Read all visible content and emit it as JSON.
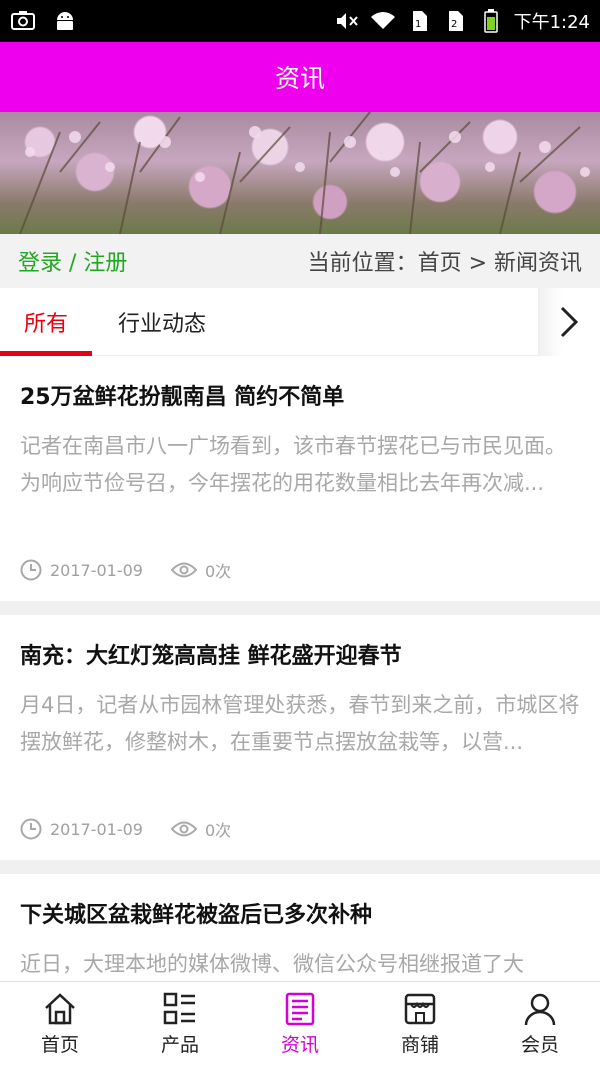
{
  "status_bar": {
    "time": "下午1:24",
    "icons": [
      "screenshot-icon",
      "android-icon",
      "mute-icon",
      "wifi-icon",
      "sim1-icon",
      "sim2-icon",
      "battery-icon"
    ]
  },
  "header": {
    "title": "资讯",
    "color": "#ee00ee"
  },
  "breadcrumb": {
    "login": "登录 / 注册",
    "location": "当前位置：首页 > 新闻资讯"
  },
  "tabs": [
    {
      "label": "所有",
      "active": true
    },
    {
      "label": "行业动态",
      "active": false
    }
  ],
  "news": [
    {
      "title": "25万盆鲜花扮靓南昌 简约不简单",
      "summary": "记者在南昌市八一广场看到，该市春节摆花已与市民见面。为响应节俭号召，今年摆花的用花数量相比去年再次减...",
      "date": "2017-01-09",
      "views": "0次"
    },
    {
      "title": "南充：大红灯笼高高挂 鲜花盛开迎春节",
      "summary": "月4日，记者从市园林管理处获悉，春节到来之前，市城区将摆放鲜花，修整树木，在重要节点摆放盆栽等，以营...",
      "date": "2017-01-09",
      "views": "0次"
    },
    {
      "title": "下关城区盆栽鲜花被盗后已多次补种",
      "summary": "近日，大理本地的媒体微博、微信公众号相继报道了大",
      "date": "",
      "views": ""
    }
  ],
  "bottom_nav": [
    {
      "label": "首页",
      "icon": "home-icon",
      "active": false
    },
    {
      "label": "产品",
      "icon": "grid-list-icon",
      "active": false
    },
    {
      "label": "资讯",
      "icon": "news-icon",
      "active": true
    },
    {
      "label": "商铺",
      "icon": "store-icon",
      "active": false
    },
    {
      "label": "会员",
      "icon": "user-icon",
      "active": false
    }
  ],
  "colors": {
    "accent": "#ee00ee",
    "tab_active": "#e60012",
    "login": "#22a722",
    "nav_active": "#d400d4"
  }
}
